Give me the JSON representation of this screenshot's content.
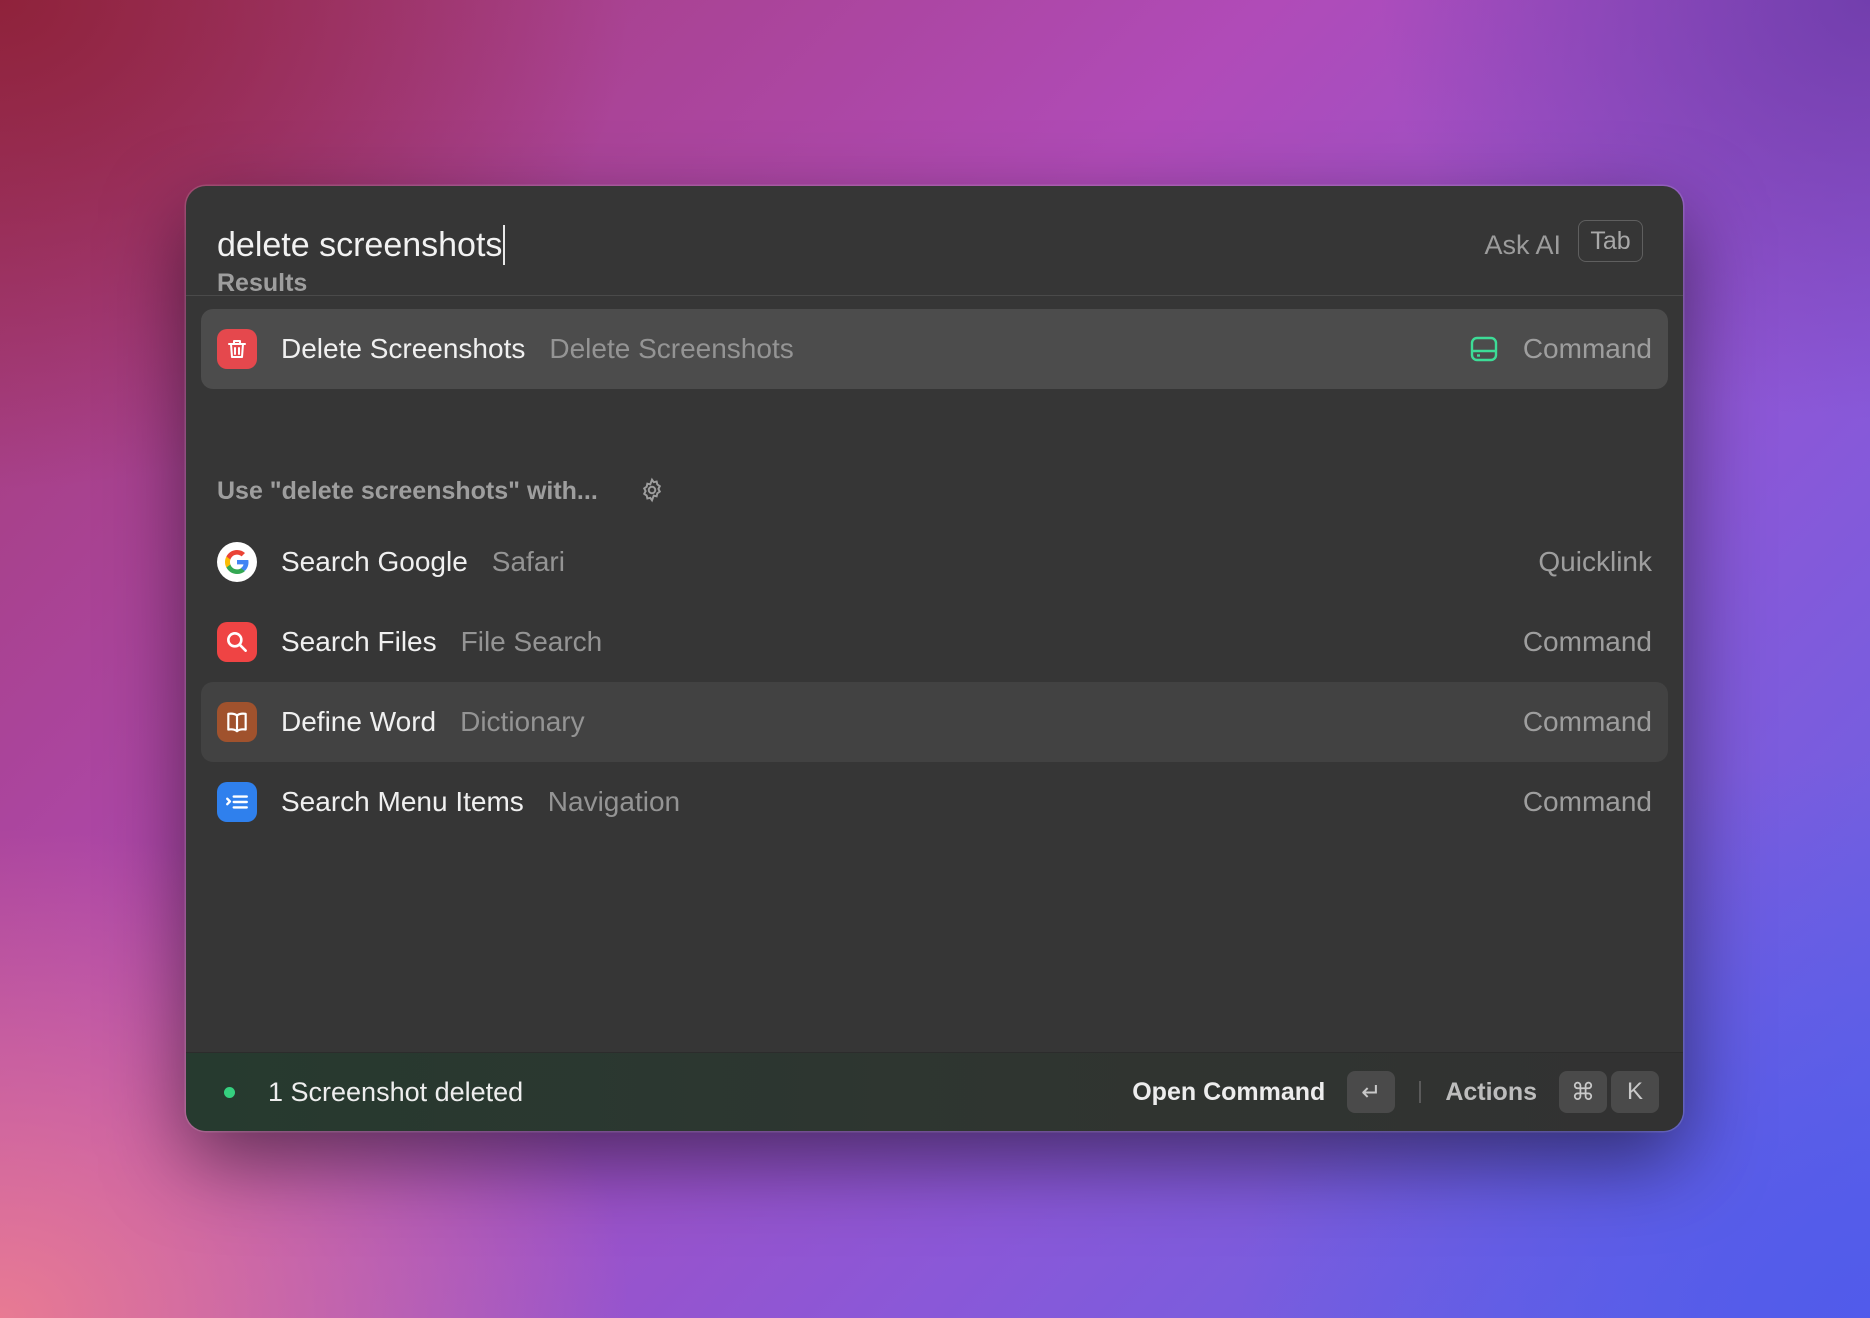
{
  "search": {
    "value": "delete screenshots",
    "ask_ai_label": "Ask AI",
    "tab_key": "Tab"
  },
  "results_section": {
    "label": "Results",
    "items": [
      {
        "title": "Delete Screenshots",
        "subtitle": "Delete Screenshots",
        "type": "Command",
        "icon": "trash-icon",
        "icon_color": "#e5484d",
        "badge_icon": "hard-drive-icon",
        "badge_color": "#3ddc97"
      }
    ]
  },
  "fallback_section": {
    "label": "Use \"delete screenshots\" with...",
    "settings_icon": "gear-icon",
    "items": [
      {
        "title": "Search Google",
        "subtitle": "Safari",
        "type": "Quicklink",
        "icon": "google-icon"
      },
      {
        "title": "Search Files",
        "subtitle": "File Search",
        "type": "Command",
        "icon": "magnifier-icon",
        "icon_color": "#ef4444"
      },
      {
        "title": "Define Word",
        "subtitle": "Dictionary",
        "type": "Command",
        "icon": "book-icon",
        "icon_color": "#a0522d"
      },
      {
        "title": "Search Menu Items",
        "subtitle": "Navigation",
        "type": "Command",
        "icon": "menu-list-icon",
        "icon_color": "#2f80ed"
      }
    ]
  },
  "footer": {
    "status_text": "1 Screenshot deleted",
    "status_color": "#35d07f",
    "primary_action": "Open Command",
    "primary_key": "↵",
    "actions_label": "Actions",
    "actions_keys": [
      "⌘",
      "K"
    ]
  }
}
